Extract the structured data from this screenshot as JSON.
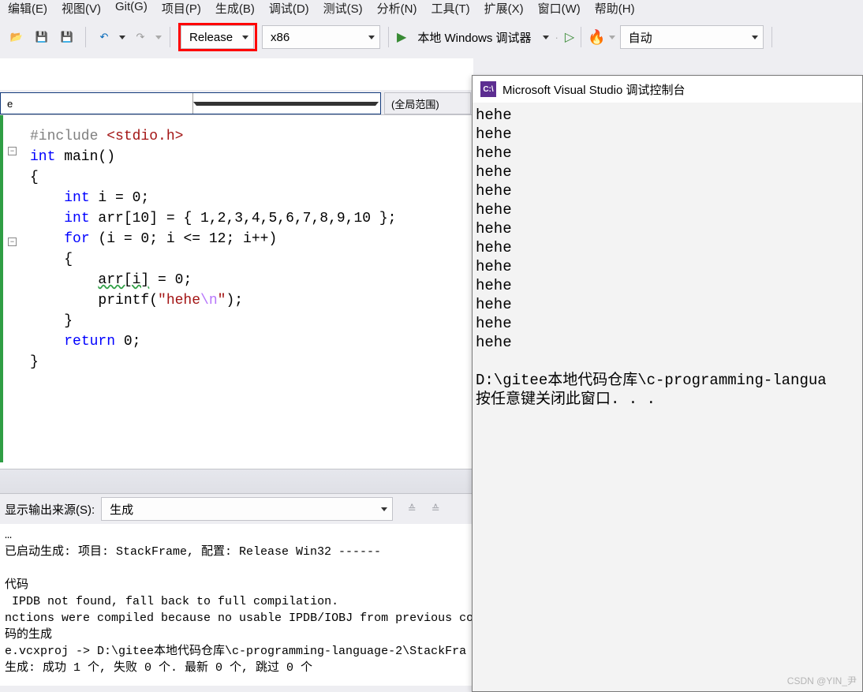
{
  "menu": {
    "items": [
      "编辑(E)",
      "视图(V)",
      "Git(G)",
      "项目(P)",
      "生成(B)",
      "调试(D)",
      "测试(S)",
      "分析(N)",
      "工具(T)",
      "扩展(X)",
      "窗口(W)",
      "帮助(H)"
    ]
  },
  "toolbar": {
    "config_label": "Release",
    "platform_label": "x86",
    "debugger_label": "本地 Windows 调试器",
    "auto_label": "自动"
  },
  "nav": {
    "combo1_text": "e",
    "combo2_text": "(全局范围)"
  },
  "code": {
    "l1a": "#include ",
    "l1b": "<stdio.h>",
    "l2a": "int",
    "l2b": " main()",
    "l3": "{",
    "l4a": "    ",
    "l4b": "int",
    "l4c": " i = 0;",
    "l5a": "    ",
    "l5b": "int",
    "l5c": " arr[10] = { 1,2,3,4,5,6,7,8,9,10 };",
    "l6a": "    ",
    "l6b": "for",
    "l6c": " (i = 0; i <= 12; i++)",
    "l7": "    {",
    "l8a": "        ",
    "l8b": "arr[i]",
    "l8c": " = 0;",
    "l9a": "        printf(",
    "l9b": "\"hehe",
    "l9c": "\\n",
    "l9d": "\"",
    "l9e": ");",
    "l10": "    }",
    "l11a": "    ",
    "l11b": "return",
    "l11c": " 0;",
    "l12": "}"
  },
  "console": {
    "title": "Microsoft Visual Studio 调试控制台",
    "hehe": "hehe",
    "path": "D:\\gitee本地代码仓库\\c-programming-langua",
    "close": "按任意键关闭此窗口. . ."
  },
  "output": {
    "source_label": "显示输出来源(S):",
    "source_value": "生成",
    "log_ellipsis": "…",
    "log1": "已启动生成: 项目: StackFrame, 配置: Release Win32 ------",
    "blank": "",
    "log2": "代码",
    "log3": " IPDB not found, fall back to full compilation.",
    "log4": "nctions were compiled because no usable IPDB/IOBJ from previous comp",
    "log5": "码的生成",
    "log6": "e.vcxproj -> D:\\gitee本地代码仓库\\c-programming-language-2\\StackFra",
    "log7": "生成: 成功 1 个, 失败 0 个. 最新 0 个, 跳过 0 个"
  },
  "watermark": "CSDN @YIN_尹"
}
